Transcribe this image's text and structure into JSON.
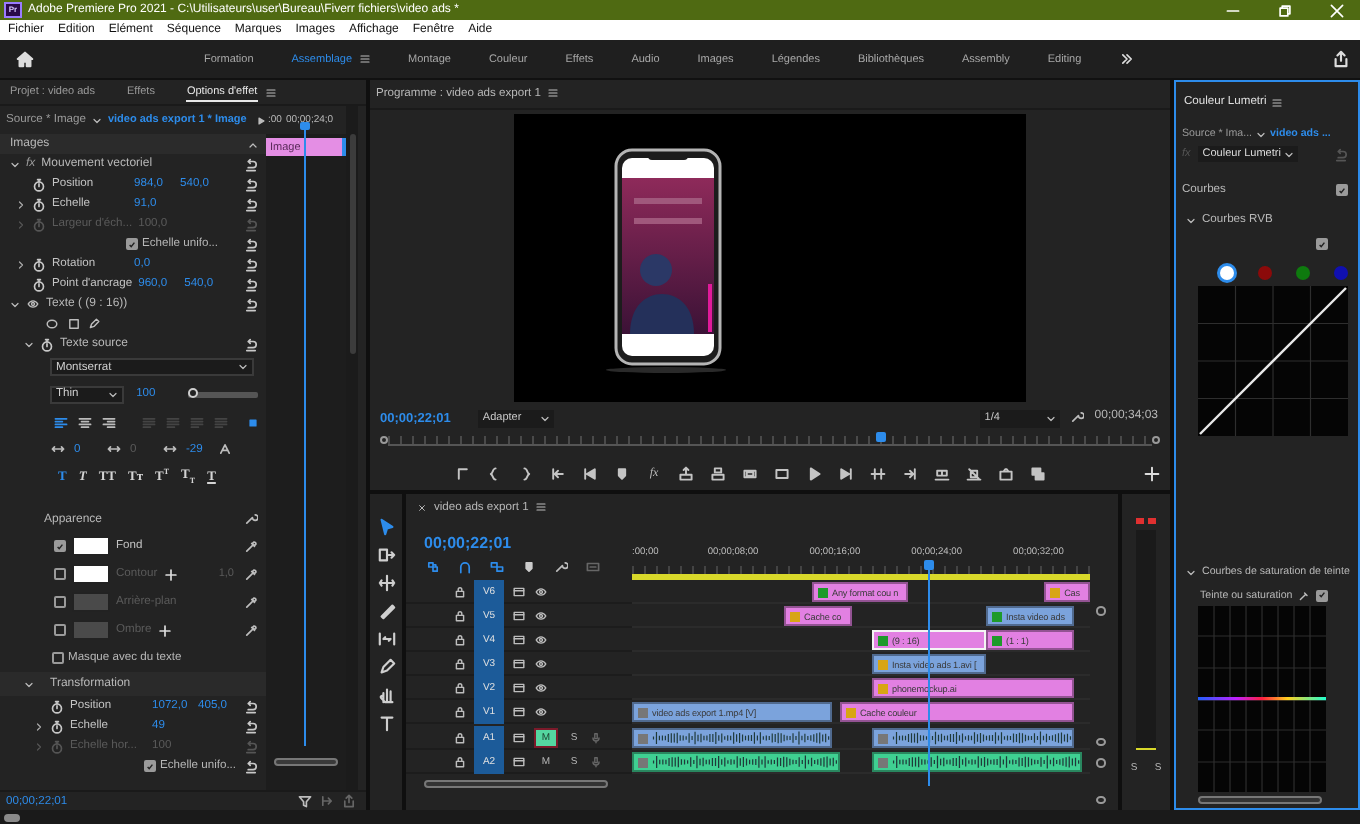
{
  "window": {
    "logo": "Pr",
    "title": "Adobe Premiere Pro 2021 - C:\\Utilisateurs\\user\\Bureau\\Fiverr fichiers\\video ads *"
  },
  "menu": [
    "Fichier",
    "Edition",
    "Elément",
    "Séquence",
    "Marques",
    "Images",
    "Affichage",
    "Fenêtre",
    "Aide"
  ],
  "workspaces": [
    {
      "label": "Formation",
      "selected": false
    },
    {
      "label": "Assemblage",
      "selected": true
    },
    {
      "label": "Montage",
      "selected": false
    },
    {
      "label": "Couleur",
      "selected": false
    },
    {
      "label": "Effets",
      "selected": false
    },
    {
      "label": "Audio",
      "selected": false
    },
    {
      "label": "Images",
      "selected": false
    },
    {
      "label": "Légendes",
      "selected": false
    },
    {
      "label": "Bibliothèques",
      "selected": false
    },
    {
      "label": "Assembly",
      "selected": false
    },
    {
      "label": "Editing",
      "selected": false
    }
  ],
  "effect_panel": {
    "tabs": [
      {
        "label": "Projet : video ads",
        "selected": false
      },
      {
        "label": "Effets",
        "selected": false
      },
      {
        "label": "Options d'effet",
        "selected": true
      }
    ],
    "source": "Source * Image",
    "clip": "video ads export 1 * Image",
    "ruler": [
      ":00",
      "00;00;24;0"
    ],
    "mini_clip": "Image",
    "playhead": {
      "level": 0.48
    },
    "rows": [
      {
        "kind": "section",
        "label": "Images"
      },
      {
        "kind": "effect",
        "badge": "fx",
        "label": "Mouvement vectoriel",
        "expanded": true
      },
      {
        "kind": "param",
        "label": "Position",
        "values": [
          "984,0",
          "540,0"
        ],
        "expandable": false,
        "disabled": false
      },
      {
        "kind": "param",
        "label": "Echelle",
        "values": [
          "91,0"
        ],
        "expandable": true,
        "disabled": false
      },
      {
        "kind": "param",
        "label": "Largeur d'éch...",
        "values": [
          "100,0"
        ],
        "expandable": true,
        "disabled": true
      },
      {
        "kind": "check",
        "label": "Echelle unifo...",
        "checked": true
      },
      {
        "kind": "param",
        "label": "Rotation",
        "values": [
          "0,0"
        ],
        "expandable": true,
        "disabled": false
      },
      {
        "kind": "param",
        "label": "Point d'ancrage",
        "values": [
          "960,0",
          "540,0"
        ],
        "expandable": false,
        "disabled": false
      },
      {
        "kind": "layer",
        "label": "Texte ( (9 : 16))",
        "expanded": true
      }
    ],
    "text_tools": {
      "source_label": "Texte source",
      "expanded": true,
      "font": "Montserrat",
      "weight": "Thin",
      "size": "100",
      "size_slider": {
        "level": 0.05
      },
      "alignments": [
        {
          "selected": true
        },
        {
          "selected": false
        },
        {
          "selected": false
        }
      ],
      "metrics": [
        {
          "value": "0",
          "disabled": false
        },
        {
          "value": "0",
          "disabled": true
        },
        {
          "value": "-29",
          "disabled": false
        }
      ],
      "styles": [
        {
          "label": "T",
          "kind": "bold",
          "selected": true
        },
        {
          "label": "T",
          "kind": "italic",
          "selected": false
        },
        {
          "label": "TT",
          "kind": "caps",
          "selected": false
        },
        {
          "label": "Tᴛ",
          "kind": "smallcaps",
          "selected": false
        },
        {
          "label": "T$^{T}$",
          "kind": "super",
          "selected": false
        },
        {
          "label": "T$_{T}$",
          "kind": "sub",
          "selected": false
        },
        {
          "label": "T",
          "kind": "underline",
          "selected": false
        }
      ]
    },
    "appearance": {
      "title": "Apparence",
      "items": [
        {
          "label": "Fond",
          "checked": true,
          "color": "#ffffff",
          "add": false
        },
        {
          "label": "Contour",
          "checked": false,
          "color": "#ffffff",
          "add": true,
          "value": "1,0"
        },
        {
          "label": "Arrière-plan",
          "checked": false,
          "color": "#4a4a4a",
          "add": false
        },
        {
          "label": "Ombre",
          "checked": false,
          "color": "#4a4a4a",
          "add": true
        }
      ],
      "mask": {
        "label": "Masque avec du texte",
        "checked": false
      }
    },
    "transform": {
      "title": "Transformation",
      "expanded": true,
      "rows": [
        {
          "kind": "param",
          "label": "Position",
          "values": [
            "1072,0",
            "405,0"
          ],
          "expandable": false,
          "disabled": false
        },
        {
          "kind": "param",
          "label": "Echelle",
          "values": [
            "49"
          ],
          "expandable": true,
          "disabled": false
        },
        {
          "kind": "param",
          "label": "Echelle hor...",
          "values": [
            "100"
          ],
          "expandable": true,
          "disabled": true
        },
        {
          "kind": "check",
          "label": "Echelle unifo...",
          "checked": true
        }
      ]
    },
    "timecode": "00;00;22;01"
  },
  "program": {
    "title": "Programme : video ads export 1",
    "timecode": "00;00;22;01",
    "fit": "Adapter",
    "resolution": "1/4",
    "duration": "00;00;34;03",
    "scrubber": {
      "level": 0.643
    },
    "fx_button": "fx"
  },
  "tools": [
    {
      "selected": true
    },
    {
      "selected": false
    },
    {
      "selected": false
    },
    {
      "selected": false
    },
    {
      "selected": false
    },
    {
      "selected": false
    },
    {
      "selected": false
    },
    {
      "selected": false
    }
  ],
  "timeline": {
    "sequence": "video ads export 1",
    "timecode": "00;00;22;01",
    "ruler": [
      ":00;00",
      "00;00;08;00",
      "00;00;16;00",
      "00;00;24;00",
      "00;00;32;00"
    ],
    "playhead": {
      "level": 0.646
    },
    "tracks": [
      {
        "label": "V6",
        "kind": "video",
        "clips": [
          {
            "label": "Any format cou n",
            "color": "#e280e2",
            "tag": {
              "color": "#1e9a2a"
            },
            "selected": false
          },
          {
            "label": "Cas",
            "color": "#e280e2",
            "tag": {
              "color": "#d8a514"
            },
            "selected": false
          }
        ]
      },
      {
        "label": "V5",
        "kind": "video",
        "clips": [
          {
            "label": "Cache co",
            "color": "#e280e2",
            "tag": {
              "color": "#d8a514"
            },
            "selected": false
          },
          {
            "label": "Insta video ads",
            "color": "#7ba3dc",
            "tag": {
              "color": "#1e9a2a"
            },
            "selected": false
          }
        ]
      },
      {
        "label": "V4",
        "kind": "video",
        "clips": [
          {
            "label": "(9 : 16)",
            "color": "#e280e2",
            "tag": {
              "color": "#1e9a2a"
            },
            "selected": true
          },
          {
            "label": "(1 : 1)",
            "color": "#e280e2",
            "tag": {
              "color": "#1e9a2a"
            },
            "selected": false
          }
        ]
      },
      {
        "label": "V3",
        "kind": "video",
        "clips": [
          {
            "label": "Insta video ads 1.avi [",
            "color": "#7ba3dc",
            "tag": {
              "color": "#d8a514"
            },
            "selected": false
          }
        ]
      },
      {
        "label": "V2",
        "kind": "video",
        "clips": [
          {
            "label": "phonemockup.ai",
            "color": "#e280e2",
            "tag": {
              "color": "#d8a514"
            },
            "selected": false
          }
        ]
      },
      {
        "label": "V1",
        "kind": "video",
        "clips": [
          {
            "label": "video ads export 1.mp4 [V]",
            "color": "#7ba3dc",
            "tag": {
              "color": "#777777"
            },
            "selected": false
          },
          {
            "label": "Cache couleur",
            "color": "#e280e2",
            "tag": {
              "color": "#d8a514"
            },
            "selected": false
          }
        ]
      },
      {
        "label": "A1",
        "kind": "audio",
        "mute": "M",
        "solo": "S",
        "muted": true,
        "clips": [
          {
            "color": "#7ba3dc",
            "tag": {
              "color": "#777777"
            },
            "selected": false
          },
          {
            "color": "#7ba3dc",
            "tag": {
              "color": "#777777"
            },
            "selected": false
          }
        ]
      },
      {
        "label": "A2",
        "kind": "audio",
        "mute": "M",
        "solo": "S",
        "muted": false,
        "clips": [
          {
            "color": "#3fd092",
            "tag": {
              "color": "#777777"
            },
            "selected": false
          },
          {
            "color": "#3fd092",
            "tag": {
              "color": "#777777"
            },
            "selected": false
          }
        ]
      }
    ]
  },
  "meter": {
    "labels": [
      "S",
      "S"
    ]
  },
  "lumetri": {
    "title": "Couleur Lumetri",
    "source": "Source * Ima...",
    "clip": "video ads ...",
    "fx": "fx",
    "effect": "Couleur Lumetri",
    "curves": {
      "label": "Courbes",
      "checked": true
    },
    "rgb": {
      "label": "Courbes RVB",
      "expanded": true,
      "checked": true,
      "channels": [
        {
          "color": "#ffffff",
          "selected": true
        },
        {
          "color": "#8b0a0a",
          "selected": false
        },
        {
          "color": "#0e7a0e",
          "selected": false
        },
        {
          "color": "#1010b0",
          "selected": false
        }
      ]
    },
    "hue": {
      "label": "Courbes de saturation de teinte",
      "expanded": true
    },
    "hue_sat": {
      "label": "Teinte ou saturation",
      "checked": true
    }
  }
}
